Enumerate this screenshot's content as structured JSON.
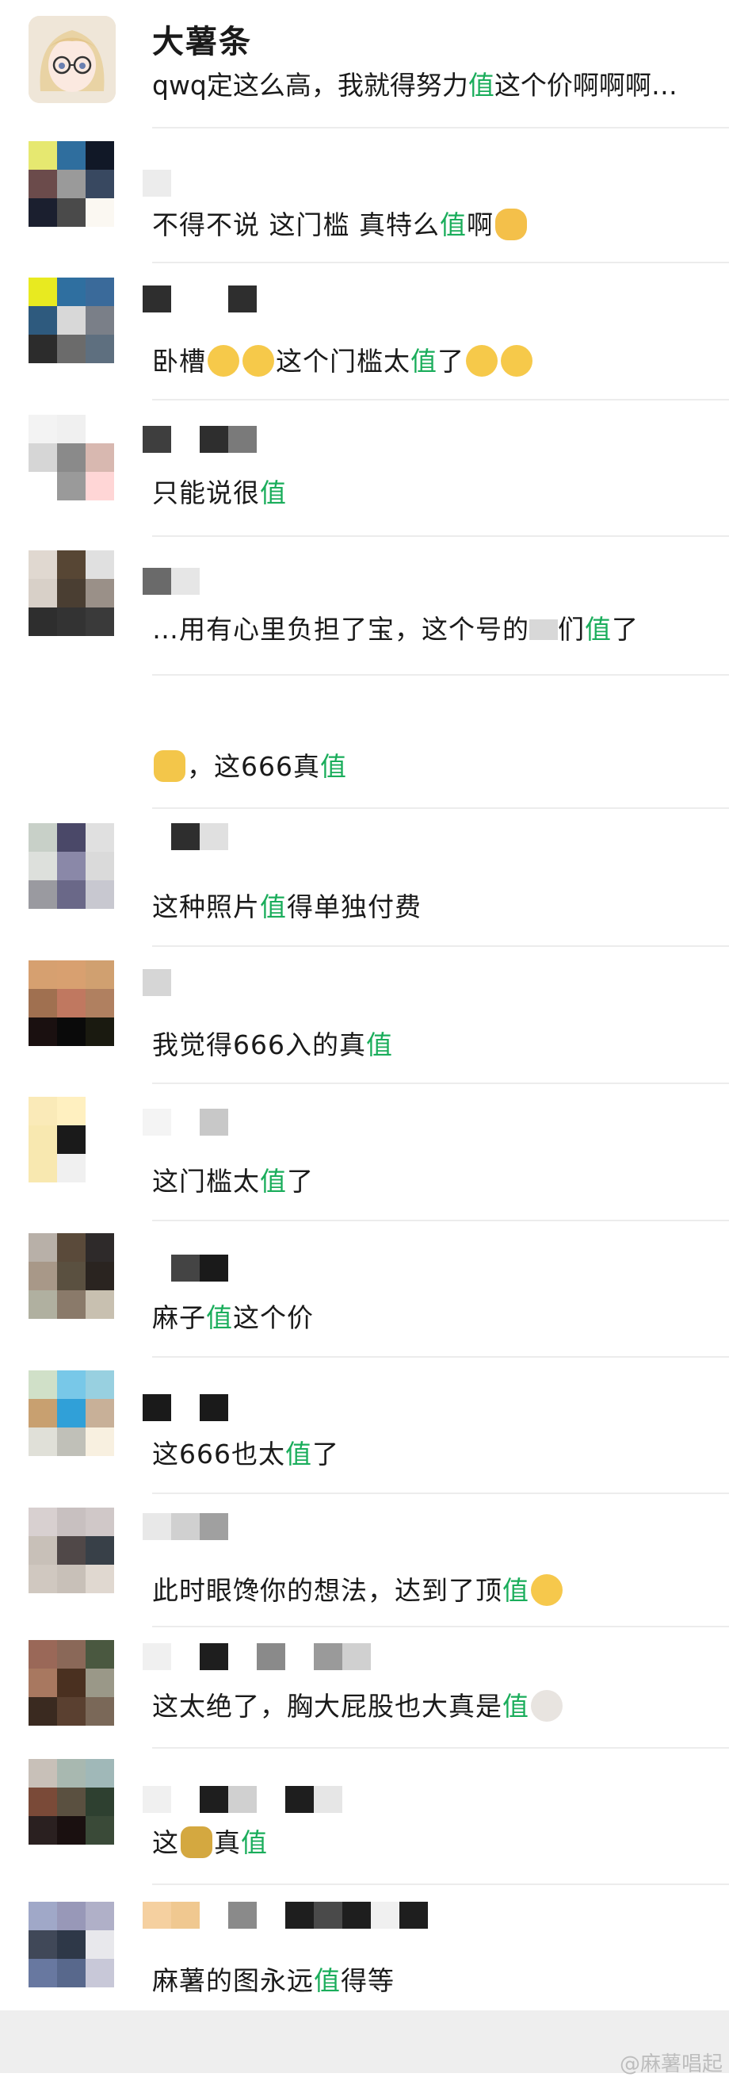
{
  "header": {
    "name": "大薯条",
    "message_pre": "qwq定这么高，我就得努力",
    "message_hl": "值",
    "message_post": "这个价啊啊啊…"
  },
  "comments": [
    {
      "pre": "不得不说 这门槛 真特么",
      "hl": "值",
      "post": "啊",
      "emoji_after": "doge-icon"
    },
    {
      "pre": "卧槽",
      "emoji_mid": "cry-icon",
      "mid": "这个门槛太",
      "hl": "值",
      "post": "了",
      "emoji_after": "cry-icon"
    },
    {
      "pre": "只能说很",
      "hl": "值",
      "post": ""
    },
    {
      "pre": "…用有心里负担了宝，这个号的",
      "mid": "们",
      "hl": "值",
      "post": "了"
    },
    {
      "pre": "",
      "emoji_before": "ok-hand-icon",
      "mid": "，这666真",
      "hl": "值",
      "post": ""
    },
    {
      "pre": "这种照片",
      "hl": "值",
      "post": "得单独付费"
    },
    {
      "pre": "我觉得666入的真",
      "hl": "值",
      "post": ""
    },
    {
      "pre": "这门槛太",
      "hl": "值",
      "post": "了"
    },
    {
      "pre": "麻子",
      "hl": "值",
      "post": "这个价"
    },
    {
      "pre": "这666也太",
      "hl": "值",
      "post": "了"
    },
    {
      "pre": "此时眼馋你的想法，达到了顶",
      "hl": "值",
      "post": "",
      "emoji_after": "flushed-icon"
    },
    {
      "pre": "这太绝了，胸大屁股也大真是",
      "hl": "值",
      "post": "",
      "emoji_after": "cow-icon"
    },
    {
      "pre": "这",
      "emoji_mid": "money-bag-icon",
      "mid": "真",
      "hl": "值",
      "post": ""
    },
    {
      "pre": "麻薯的图永远",
      "hl": "值",
      "post": "得等"
    }
  ],
  "watermark": "@麻薯唱起",
  "colors": {
    "highlight": "#1aad5b",
    "divider": "#ececec",
    "bottom_bar": "#eeeeee"
  }
}
